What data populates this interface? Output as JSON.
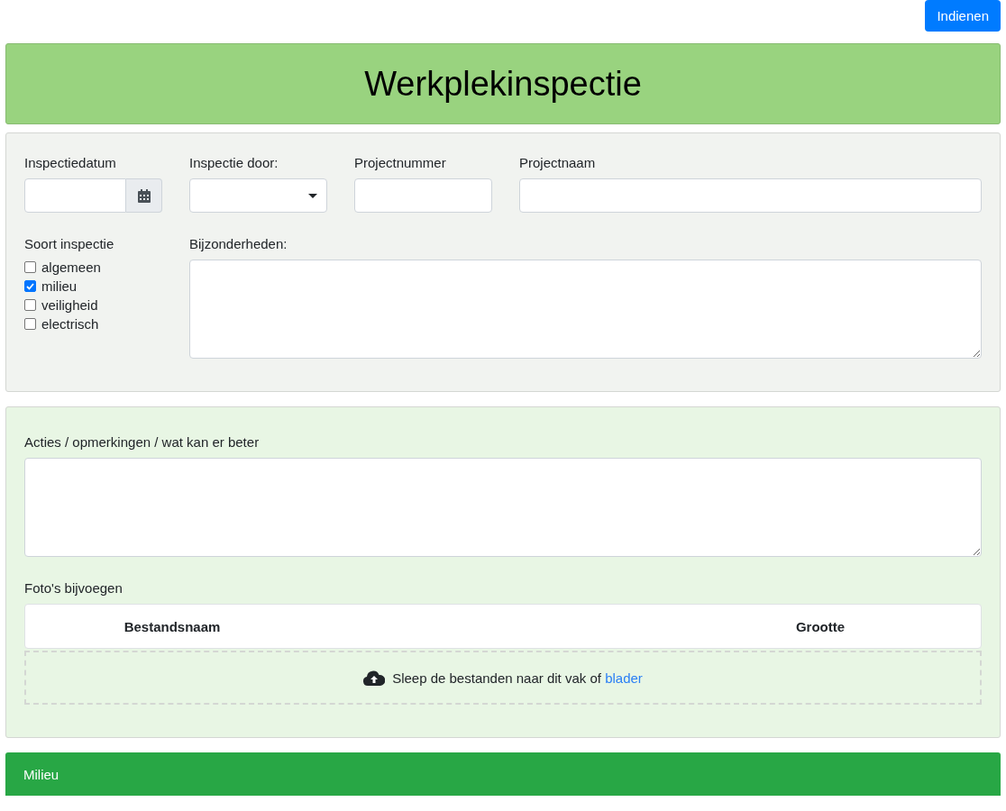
{
  "submit_button": "Indienen",
  "header": {
    "title": "Werkplekinspectie"
  },
  "inspection": {
    "date": {
      "label": "Inspectiedatum"
    },
    "inspector": {
      "label": "Inspectie door:"
    },
    "project_number": {
      "label": "Projectnummer"
    },
    "project_name": {
      "label": "Projectnaam"
    },
    "type": {
      "label": "Soort inspectie",
      "options": [
        {
          "label": "algemeen",
          "checked": false
        },
        {
          "label": "milieu",
          "checked": true
        },
        {
          "label": "veiligheid",
          "checked": false
        },
        {
          "label": "electrisch",
          "checked": false
        }
      ]
    },
    "details": {
      "label": "Bijzonderheden:"
    }
  },
  "actions": {
    "label": "Acties / opmerkingen / wat kan er beter",
    "photos": {
      "label": "Foto's bijvoegen",
      "columns": [
        "Bestandsnaam",
        "Grootte"
      ],
      "dropzone": {
        "text": "Sleep de bestanden naar dit vak of ",
        "link": "blader"
      }
    }
  },
  "section": {
    "title": "Milieu"
  }
}
